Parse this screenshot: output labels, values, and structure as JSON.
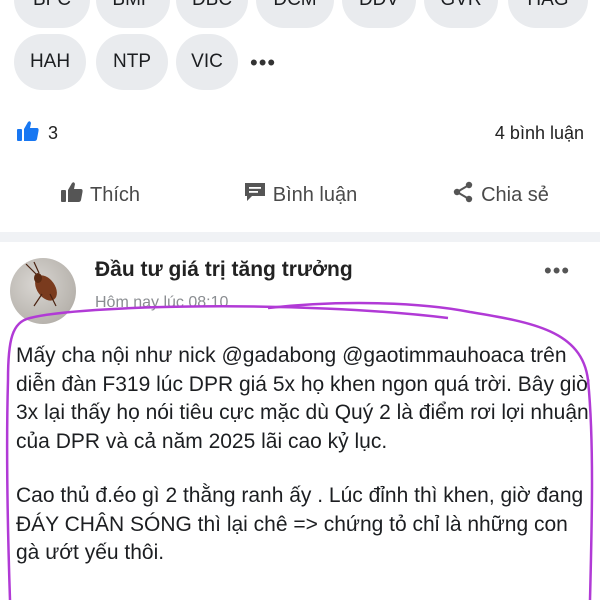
{
  "tickers_row1": [
    "BFC",
    "BMP",
    "DBC",
    "DCM",
    "DDV",
    "GVR",
    "HAG"
  ],
  "tickers_row2": [
    "HAH",
    "NTP",
    "VIC"
  ],
  "more_tickers": "•••",
  "reactions": {
    "like_count": "3",
    "comments": "4 bình luận"
  },
  "actions": {
    "like": "Thích",
    "comment": "Bình luận",
    "share": "Chia sẻ"
  },
  "post": {
    "author": "Đầu tư giá trị tăng trưởng",
    "time": "Hôm nay lúc 08:10",
    "more": "•••",
    "paragraph1": "Mấy cha nội như nick @gadabong @gaotimmauhoaca trên diễn đàn F319 lúc DPR giá 5x họ khen ngon quá trời. Bây giờ 3x lại thấy họ nói tiêu cực mặc dù Quý 2 là điểm rơi lợi nhuận của DPR và cả năm 2025 lãi cao kỷ lục.",
    "paragraph2": "Cao thủ đ.éo gì 2 thằng ranh ấy . Lúc đỉnh thì khen, giờ đang ĐÁY CHÂN SÓNG thì lại chê => chứng tỏ chỉ là những con gà ướt yếu thôi."
  },
  "colors": {
    "accent": "#1877f2",
    "annotation": "#b13ad6"
  }
}
